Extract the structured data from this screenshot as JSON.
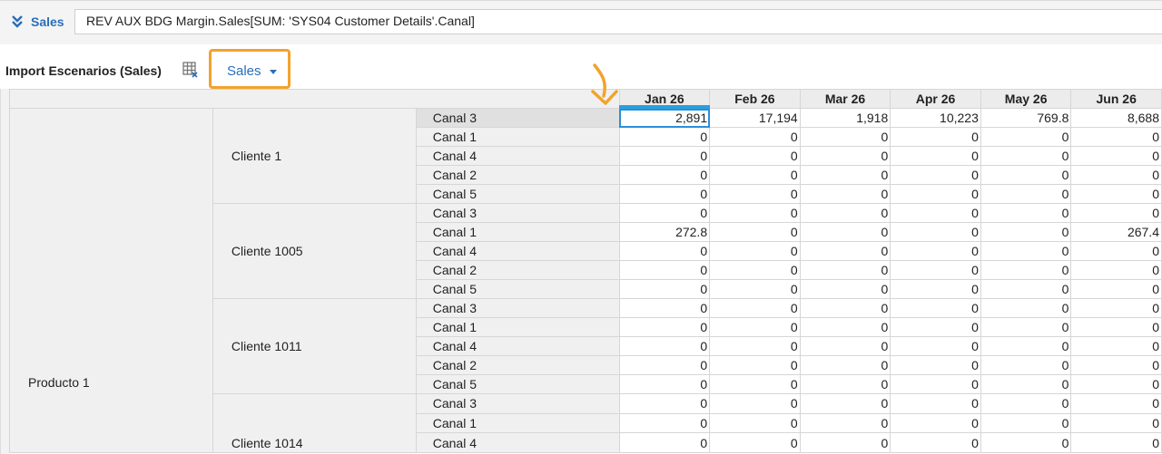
{
  "formula_bar": {
    "label": "Sales",
    "formula": "REV AUX BDG Margin.Sales[SUM: 'SYS04 Customer Details'.Canal]"
  },
  "sheet": {
    "title": "Import Escenarios (Sales)",
    "scenario_dropdown": "Sales"
  },
  "grid": {
    "columns": [
      "Jan 26",
      "Feb 26",
      "Mar 26",
      "Apr 26",
      "May 26",
      "Jun 26"
    ],
    "product": "Producto 1",
    "clients": [
      {
        "name": "Cliente 1",
        "rows": [
          {
            "canal": "Canal 3",
            "values": [
              "2,891",
              "17,194",
              "1,918",
              "10,223",
              "769.8",
              "8,688"
            ]
          },
          {
            "canal": "Canal 1",
            "values": [
              "0",
              "0",
              "0",
              "0",
              "0",
              "0"
            ]
          },
          {
            "canal": "Canal 4",
            "values": [
              "0",
              "0",
              "0",
              "0",
              "0",
              "0"
            ]
          },
          {
            "canal": "Canal 2",
            "values": [
              "0",
              "0",
              "0",
              "0",
              "0",
              "0"
            ]
          },
          {
            "canal": "Canal 5",
            "values": [
              "0",
              "0",
              "0",
              "0",
              "0",
              "0"
            ]
          }
        ]
      },
      {
        "name": "Cliente 1005",
        "rows": [
          {
            "canal": "Canal 3",
            "values": [
              "0",
              "0",
              "0",
              "0",
              "0",
              "0"
            ]
          },
          {
            "canal": "Canal 1",
            "values": [
              "272.8",
              "0",
              "0",
              "0",
              "0",
              "267.4"
            ]
          },
          {
            "canal": "Canal 4",
            "values": [
              "0",
              "0",
              "0",
              "0",
              "0",
              "0"
            ]
          },
          {
            "canal": "Canal 2",
            "values": [
              "0",
              "0",
              "0",
              "0",
              "0",
              "0"
            ]
          },
          {
            "canal": "Canal 5",
            "values": [
              "0",
              "0",
              "0",
              "0",
              "0",
              "0"
            ]
          }
        ]
      },
      {
        "name": "Cliente 1011",
        "rows": [
          {
            "canal": "Canal 3",
            "values": [
              "0",
              "0",
              "0",
              "0",
              "0",
              "0"
            ]
          },
          {
            "canal": "Canal 1",
            "values": [
              "0",
              "0",
              "0",
              "0",
              "0",
              "0"
            ]
          },
          {
            "canal": "Canal 4",
            "values": [
              "0",
              "0",
              "0",
              "0",
              "0",
              "0"
            ]
          },
          {
            "canal": "Canal 2",
            "values": [
              "0",
              "0",
              "0",
              "0",
              "0",
              "0"
            ]
          },
          {
            "canal": "Canal 5",
            "values": [
              "0",
              "0",
              "0",
              "0",
              "0",
              "0"
            ]
          }
        ]
      },
      {
        "name": "Cliente 1014",
        "rows": [
          {
            "canal": "Canal 3",
            "values": [
              "0",
              "0",
              "0",
              "0",
              "0",
              "0"
            ]
          },
          {
            "canal": "Canal 1",
            "values": [
              "0",
              "0",
              "0",
              "0",
              "0",
              "0"
            ]
          },
          {
            "canal": "Canal 4",
            "values": [
              "0",
              "0",
              "0",
              "0",
              "0",
              "0"
            ]
          }
        ]
      }
    ]
  },
  "colors": {
    "accent": "#2a6ebb",
    "highlight_box": "#f2a32c",
    "selection": "#2b9ee0"
  },
  "icons": [
    "double-chevron-down-icon",
    "table-settings-icon",
    "caret-down-icon",
    "annotation-arrow-icon"
  ]
}
